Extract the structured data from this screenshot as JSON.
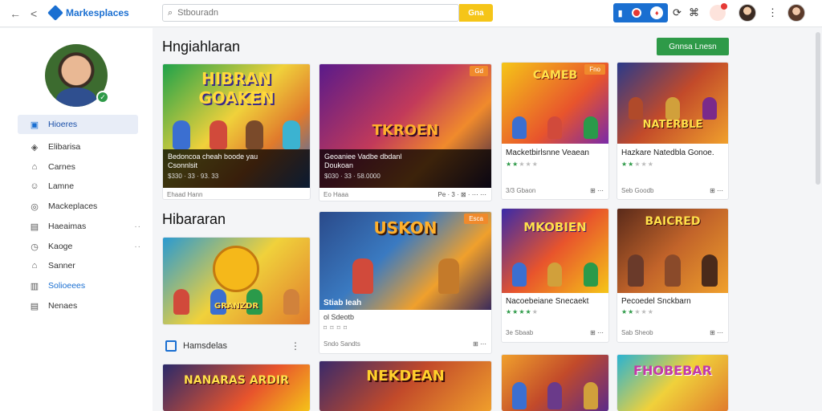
{
  "topbar": {
    "back_icon": "←",
    "forward_icon": "<",
    "brand": "Markesplaces",
    "search_placeholder": "Stbouradn",
    "search_button": "Gna"
  },
  "sidebar": {
    "items": [
      {
        "label": "Hioeres",
        "icon": "▣"
      },
      {
        "label": "Elibarisa",
        "icon": "◈"
      },
      {
        "label": "Carnes",
        "icon": "⌂"
      },
      {
        "label": "Lamne",
        "icon": "☺"
      },
      {
        "label": "Mackeplaces",
        "icon": "◎"
      },
      {
        "label": "Haeaimas",
        "icon": "▤"
      },
      {
        "label": "Kaoge",
        "icon": "◷"
      },
      {
        "label": "Sanner",
        "icon": "⌂"
      },
      {
        "label": "Solioeees",
        "icon": "▥"
      },
      {
        "label": "Nenaes",
        "icon": "▤"
      }
    ],
    "more": "··"
  },
  "main": {
    "heading1": "Hngiahlaran",
    "heading2": "Hibararan",
    "green_button": "Gnnsa Lnesn",
    "side_label": "Hamsdelas"
  },
  "cards": {
    "c1": {
      "title": "HIBRAN GOAKEN",
      "sub1": "Bedoncoa cheah boode yau",
      "sub2": "Csonnlsit",
      "sub3": "$330 · 33 · 93. 33",
      "foot": "Ehaad Hann"
    },
    "c2": {
      "title": "TKROEN",
      "sub1": "Geoaniee Vadbe dbdanl",
      "sub2": "Doukoan",
      "sub3": "$030 · 33 · 58.0000",
      "foot": "Eo Haaa",
      "foot_r": "Pe · 3 · ⊠ · ⋯ ⋯",
      "badge": "Gd"
    },
    "c3": {
      "title": "CAMEB",
      "name": "Macketbirlsnne Veaean",
      "foot": "3/3 Gbaon",
      "foot_r": "⊞ ⋯",
      "badge": "Fno"
    },
    "c4": {
      "title": "NATERBLE",
      "name": "Hazkare Natedbla Gonoe.",
      "foot": "Seb Goodb",
      "foot_r": "⊞ ⋯"
    },
    "c5": {
      "title": "USKON",
      "name": "Stiab Ieah",
      "sub": "ol Sdeotb",
      "foot": "Sndo Sandts",
      "foot_r": "⊞ ⋯",
      "badge": "Esca"
    },
    "c6": {
      "title": "MKOBIEN",
      "name": "Nacoebeiane Snecaekt",
      "foot": "3e Sbaab",
      "foot_r": "⊞ ⋯"
    },
    "c7": {
      "title": "BAICRED",
      "name": "Pecoedel Snckbarn",
      "foot": "Sab Sheob",
      "foot_r": "⊞ ⋯"
    },
    "c8": {
      "title": "GRANZDR",
      "sub": "GRANZDR"
    },
    "c9": {
      "title": "NANARAS ARDIR"
    },
    "c10": {
      "title": "NEKDEAN"
    },
    "c11": {
      "title": ""
    },
    "c12": {
      "title": "FHOBEBAR"
    }
  }
}
